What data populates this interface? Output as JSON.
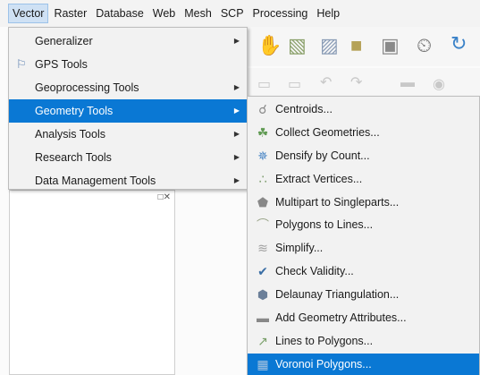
{
  "menubar": {
    "items": [
      {
        "label": "Vector",
        "active": true
      },
      {
        "label": "Raster"
      },
      {
        "label": "Database"
      },
      {
        "label": "Web"
      },
      {
        "label": "Mesh"
      },
      {
        "label": "SCP"
      },
      {
        "label": "Processing"
      },
      {
        "label": "Help"
      }
    ]
  },
  "vector_menu": {
    "items": [
      {
        "label": "Generalizer",
        "submenu": true
      },
      {
        "label": "GPS Tools",
        "icon": "gps-icon"
      },
      {
        "label": "Geoprocessing Tools",
        "submenu": true
      },
      {
        "label": "Geometry Tools",
        "submenu": true,
        "highlighted": true
      },
      {
        "label": "Analysis Tools",
        "submenu": true
      },
      {
        "label": "Research Tools",
        "submenu": true
      },
      {
        "label": "Data Management Tools",
        "submenu": true
      }
    ]
  },
  "geometry_menu": {
    "items": [
      {
        "label": "Centroids...",
        "icon": "centroids-icon"
      },
      {
        "label": "Collect Geometries...",
        "icon": "collect-geometries-icon"
      },
      {
        "label": "Densify by Count...",
        "icon": "densify-icon"
      },
      {
        "label": "Extract Vertices...",
        "icon": "extract-vertices-icon"
      },
      {
        "label": "Multipart to Singleparts...",
        "icon": "multipart-icon"
      },
      {
        "label": "Polygons to Lines...",
        "icon": "polygons-to-lines-icon"
      },
      {
        "label": "Simplify...",
        "icon": "simplify-icon"
      },
      {
        "label": "Check Validity...",
        "icon": "check-icon"
      },
      {
        "label": "Delaunay Triangulation...",
        "icon": "delaunay-icon"
      },
      {
        "label": "Add Geometry Attributes...",
        "icon": "geometry-attributes-icon"
      },
      {
        "label": "Lines to Polygons...",
        "icon": "lines-to-polygons-icon"
      },
      {
        "label": "Voronoi Polygons...",
        "icon": "voronoi-icon",
        "highlighted": true
      }
    ]
  },
  "panel": {
    "buttons": "□✕"
  }
}
